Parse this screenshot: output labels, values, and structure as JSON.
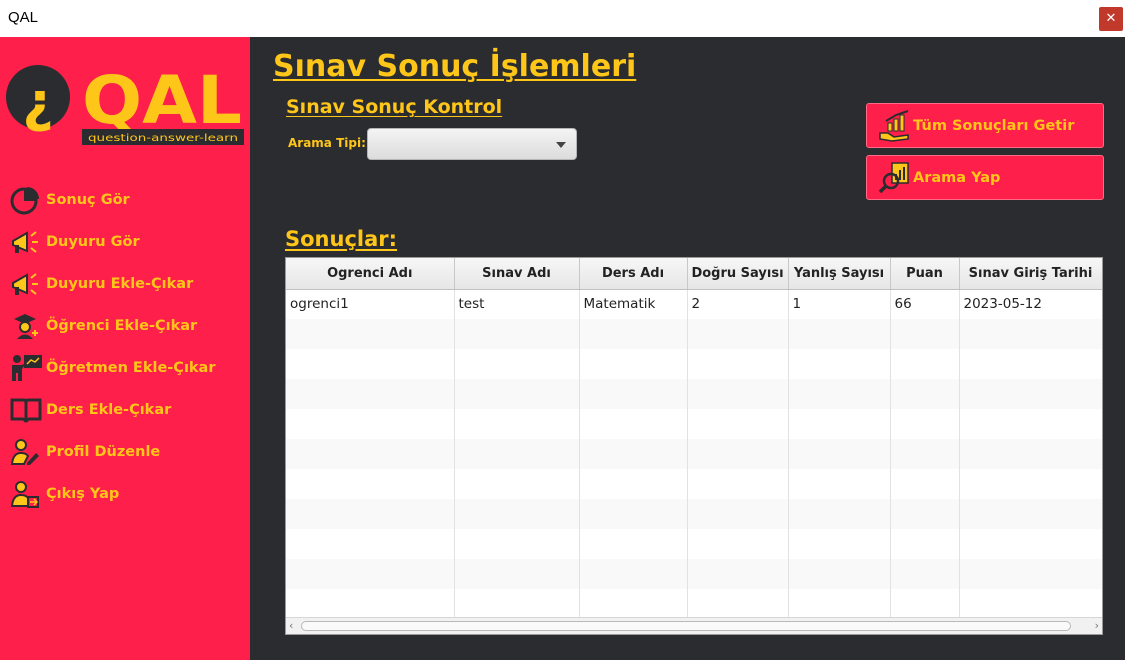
{
  "window": {
    "title": "QAL",
    "close_glyph": "✕"
  },
  "logo": {
    "text": "QAL",
    "tagline": "question-answer-learn",
    "icon": "inverted-question-mark-icon"
  },
  "sidebar": {
    "items": [
      {
        "label": "Sonuç Gör",
        "icon": "pie-chart-icon"
      },
      {
        "label": "Duyuru Gör",
        "icon": "megaphone-icon"
      },
      {
        "label": "Duyuru Ekle-Çıkar",
        "icon": "megaphone-icon"
      },
      {
        "label": "Öğrenci Ekle-Çıkar",
        "icon": "graduate-icon"
      },
      {
        "label": "Öğretmen Ekle-Çıkar",
        "icon": "teacher-icon"
      },
      {
        "label": "Ders Ekle-Çıkar",
        "icon": "book-icon"
      },
      {
        "label": "Profil Düzenle",
        "icon": "user-edit-icon"
      },
      {
        "label": "Çıkış Yap",
        "icon": "logout-icon"
      }
    ]
  },
  "main": {
    "page_title": "Sınav Sonuç İşlemleri",
    "section_title": "Sınav Sonuç Kontrol",
    "search_type_label": "Arama Tipi:",
    "search_type_value": "",
    "buttons": {
      "get_all": "Tüm Sonuçları Getir",
      "search": "Arama Yap"
    },
    "results_title": "Sonuçlar:",
    "table": {
      "headers": [
        "Ogrenci Adı",
        "Sınav Adı",
        "Ders Adı",
        "Doğru Sayısı",
        "Yanlış Sayısı",
        "Puan",
        "Sınav Giriş Tarihi"
      ],
      "rows": [
        [
          "ogrenci1",
          "test",
          "Matematik",
          "2",
          "1",
          "66",
          "2023-05-12"
        ]
      ]
    }
  },
  "colors": {
    "sidebar": "#ff1f4b",
    "accent": "#ffc61a",
    "background": "#2b2c2f"
  }
}
